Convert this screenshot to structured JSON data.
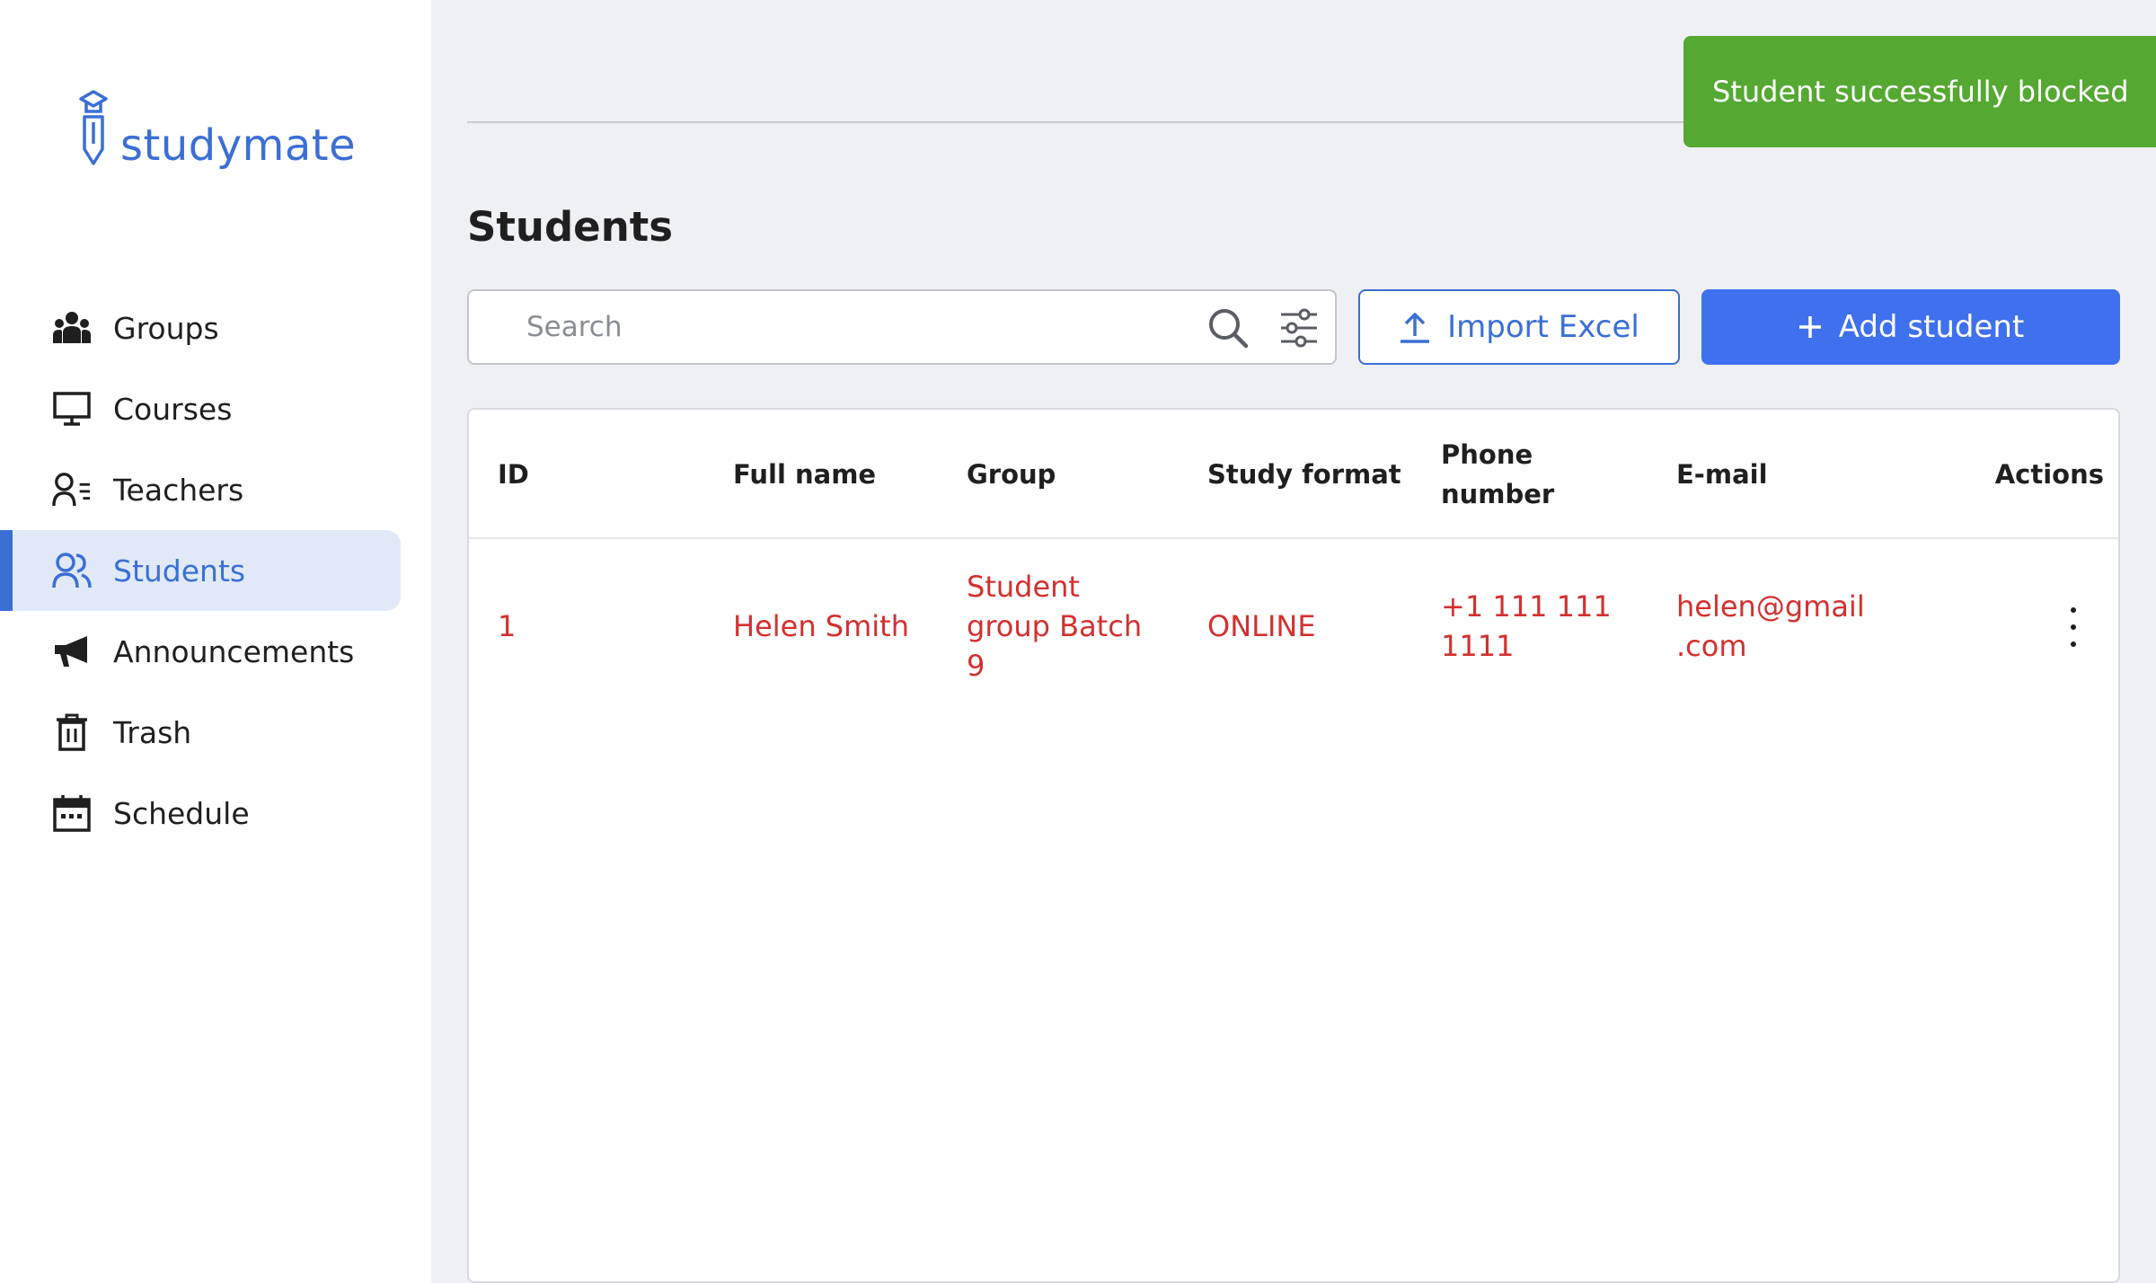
{
  "app": {
    "brand": "studymate"
  },
  "sidebar": {
    "items": [
      {
        "label": "Groups",
        "icon": "groups-icon",
        "active": false
      },
      {
        "label": "Courses",
        "icon": "monitor-icon",
        "active": false
      },
      {
        "label": "Teachers",
        "icon": "teacher-icon",
        "active": false
      },
      {
        "label": "Students",
        "icon": "students-icon",
        "active": true
      },
      {
        "label": "Announcements",
        "icon": "megaphone-icon",
        "active": false
      },
      {
        "label": "Trash",
        "icon": "trash-icon",
        "active": false
      },
      {
        "label": "Schedule",
        "icon": "calendar-icon",
        "active": false
      }
    ]
  },
  "toast": {
    "message": "Student successfully blocked",
    "color": "#55a832"
  },
  "page": {
    "title": "Students"
  },
  "search": {
    "placeholder": "Search",
    "value": ""
  },
  "toolbar": {
    "import_label": "Import Excel",
    "add_label": "Add student"
  },
  "table": {
    "columns": [
      "ID",
      "Full name",
      "Group",
      "Study format",
      "Phone number",
      "E-mail",
      "Actions"
    ],
    "rows": [
      {
        "id": "1",
        "full_name": "Helen Smith",
        "group": "Student group Batch 9",
        "study_format": "ONLINE",
        "phone": "+1 111 111 1111",
        "email": "helen@gmail .com"
      }
    ]
  },
  "colors": {
    "accent": "#3a6fd6",
    "primary_button": "#3f70ee",
    "row_text": "#d3302f",
    "sidebar_active_bg": "#e1e9f8"
  }
}
